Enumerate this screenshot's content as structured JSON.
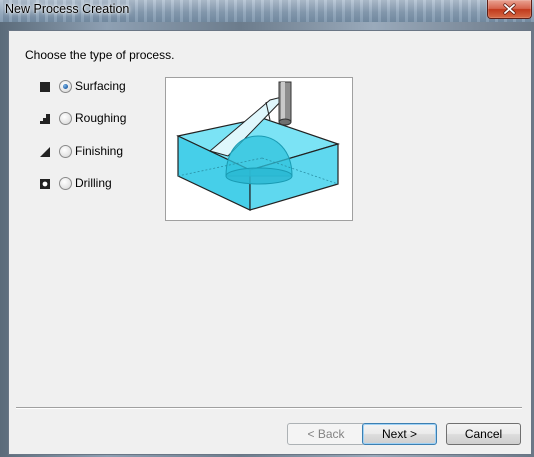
{
  "window": {
    "title": "New Process Creation"
  },
  "dialog": {
    "prompt": "Choose the type of process.",
    "options": [
      {
        "label": "Surfacing",
        "icon": "surfacing-icon",
        "selected": true
      },
      {
        "label": "Roughing",
        "icon": "roughing-icon",
        "selected": false
      },
      {
        "label": "Finishing",
        "icon": "finishing-icon",
        "selected": false
      },
      {
        "label": "Drilling",
        "icon": "drilling-icon",
        "selected": false
      }
    ],
    "preview": {
      "icon": "surfacing-preview-image"
    }
  },
  "buttons": {
    "back": "< Back",
    "next": "Next >",
    "cancel": "Cancel"
  },
  "colors": {
    "block_fill": "#58d6ee",
    "block_top": "#7be3f5",
    "dome": "#2fc3dc",
    "accent_radio": "#1f5fa8"
  }
}
